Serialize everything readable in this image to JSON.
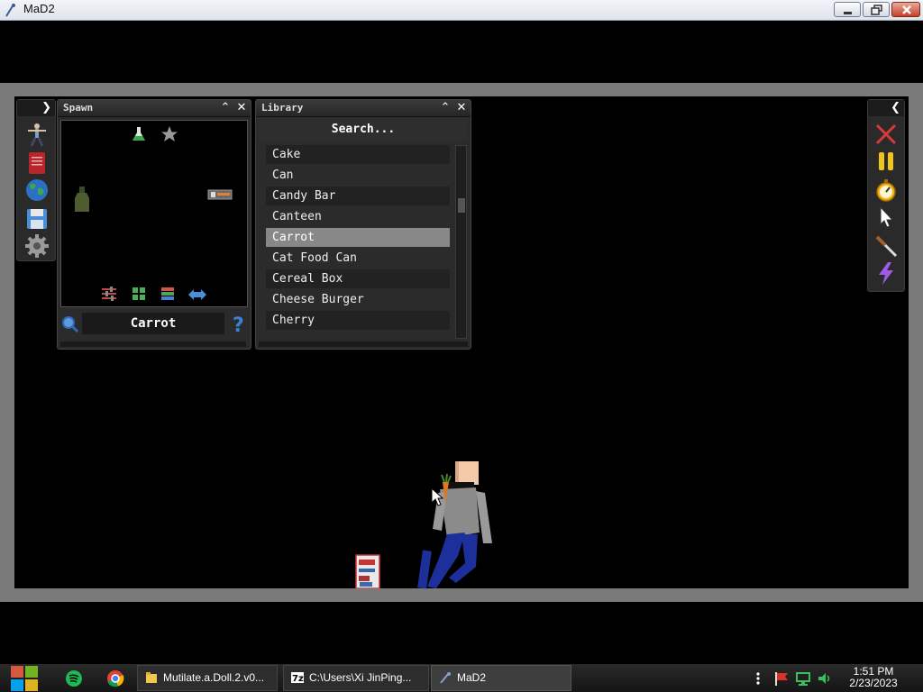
{
  "window": {
    "title": "MaD2"
  },
  "spawn_panel": {
    "title": "Spawn",
    "selected_item": "Carrot"
  },
  "library_panel": {
    "title": "Library",
    "search_placeholder": "Search...",
    "items": [
      {
        "label": "Cake"
      },
      {
        "label": "Can"
      },
      {
        "label": "Candy Bar"
      },
      {
        "label": "Canteen"
      },
      {
        "label": "Carrot",
        "selected": true
      },
      {
        "label": "Cat Food Can"
      },
      {
        "label": "Cereal Box"
      },
      {
        "label": "Cheese Burger"
      },
      {
        "label": "Cherry"
      }
    ]
  },
  "left_toolbar": {
    "icons": [
      "ragdoll-icon",
      "book-icon",
      "globe-icon",
      "save-icon",
      "settings-gear-icon"
    ]
  },
  "right_toolbar": {
    "icons": [
      "delete-x-icon",
      "pause-icon",
      "stopwatch-icon",
      "pointer-icon",
      "knife-icon",
      "lightning-icon"
    ]
  },
  "taskbar": {
    "tasks": [
      {
        "label": "Mutilate.a.Doll.2.v0..."
      },
      {
        "label": "C:\\Users\\Xi JinPing..."
      },
      {
        "label": "MaD2",
        "active": true
      }
    ],
    "clock": {
      "time": "1:51 PM",
      "date": "2/23/2023"
    }
  }
}
